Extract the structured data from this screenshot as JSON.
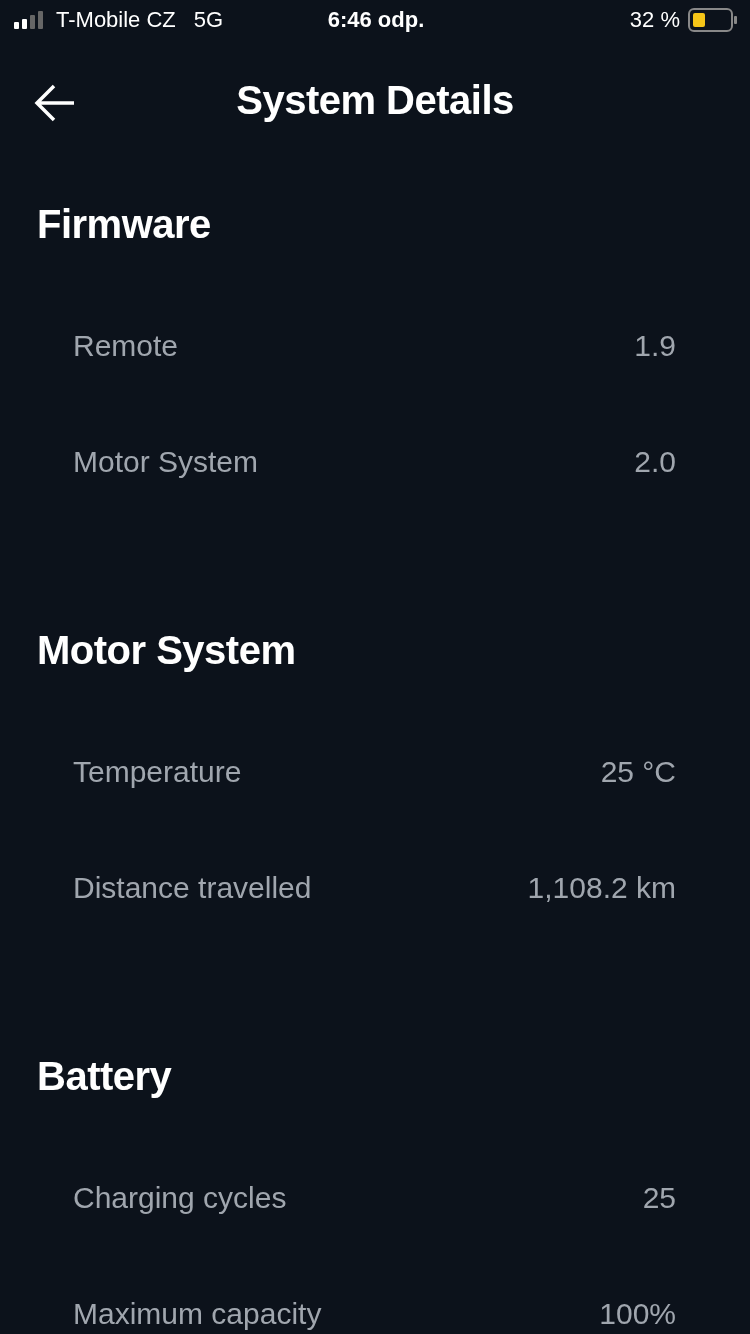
{
  "status_bar": {
    "carrier": "T-Mobile CZ",
    "network": "5G",
    "time": "6:46 odp.",
    "battery": "32 %"
  },
  "header": {
    "title": "System Details"
  },
  "sections": [
    {
      "title": "Firmware",
      "rows": [
        {
          "label": "Remote",
          "value": "1.9"
        },
        {
          "label": "Motor System",
          "value": "2.0"
        }
      ]
    },
    {
      "title": "Motor System",
      "rows": [
        {
          "label": "Temperature",
          "value": "25 °C"
        },
        {
          "label": "Distance travelled",
          "value": "1,108.2 km"
        }
      ]
    },
    {
      "title": "Battery",
      "rows": [
        {
          "label": "Charging cycles",
          "value": "25"
        },
        {
          "label": "Maximum capacity",
          "value": "100%"
        }
      ]
    }
  ]
}
